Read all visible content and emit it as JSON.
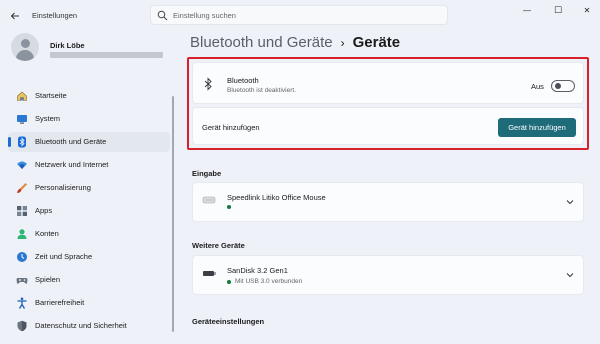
{
  "window": {
    "app_title": "Einstellungen",
    "back_icon": "back-arrow-icon",
    "controls": {
      "minimize": "—",
      "maximize": "☐",
      "close": "✕"
    }
  },
  "search": {
    "placeholder": "Einstellung suchen",
    "value": ""
  },
  "profile": {
    "name": "Dirk Löbe"
  },
  "sidebar": {
    "items": [
      {
        "label": "Startseite",
        "icon": "home-icon",
        "active": false
      },
      {
        "label": "System",
        "icon": "system-icon",
        "active": false
      },
      {
        "label": "Bluetooth und Geräte",
        "icon": "bluetooth-icon",
        "active": true
      },
      {
        "label": "Netzwerk und Internet",
        "icon": "wifi-icon",
        "active": false
      },
      {
        "label": "Personalisierung",
        "icon": "brush-icon",
        "active": false
      },
      {
        "label": "Apps",
        "icon": "apps-icon",
        "active": false
      },
      {
        "label": "Konten",
        "icon": "account-icon",
        "active": false
      },
      {
        "label": "Zeit und Sprache",
        "icon": "globe-clock-icon",
        "active": false
      },
      {
        "label": "Spielen",
        "icon": "gamepad-icon",
        "active": false
      },
      {
        "label": "Barrierefreiheit",
        "icon": "accessibility-icon",
        "active": false
      },
      {
        "label": "Datenschutz und Sicherheit",
        "icon": "shield-icon",
        "active": false
      }
    ]
  },
  "breadcrumb": {
    "parent": "Bluetooth und Geräte",
    "separator": "›",
    "current": "Geräte"
  },
  "bluetooth": {
    "title": "Bluetooth",
    "subtitle": "Bluetooth ist deaktiviert.",
    "toggle_label": "Aus",
    "toggle_on": false
  },
  "add_device": {
    "label": "Gerät hinzufügen",
    "button": "Gerät hinzufügen"
  },
  "sections": {
    "input": {
      "title": "Eingabe",
      "devices": [
        {
          "name": "Speedlink Litiko Office Mouse",
          "status": "",
          "icon": "mouse-icon"
        }
      ]
    },
    "other": {
      "title": "Weitere Geräte",
      "devices": [
        {
          "name": "SanDisk 3.2 Gen1",
          "status": "Mit USB 3.0 verbunden",
          "icon": "usb-drive-icon"
        }
      ]
    },
    "settings": {
      "title": "Geräteeinstellungen"
    }
  },
  "colors": {
    "accent": "#1e6b7a",
    "nav_indicator": "#1a6dd8",
    "highlight_border": "#d8202a",
    "status_connected": "#127a3a"
  }
}
